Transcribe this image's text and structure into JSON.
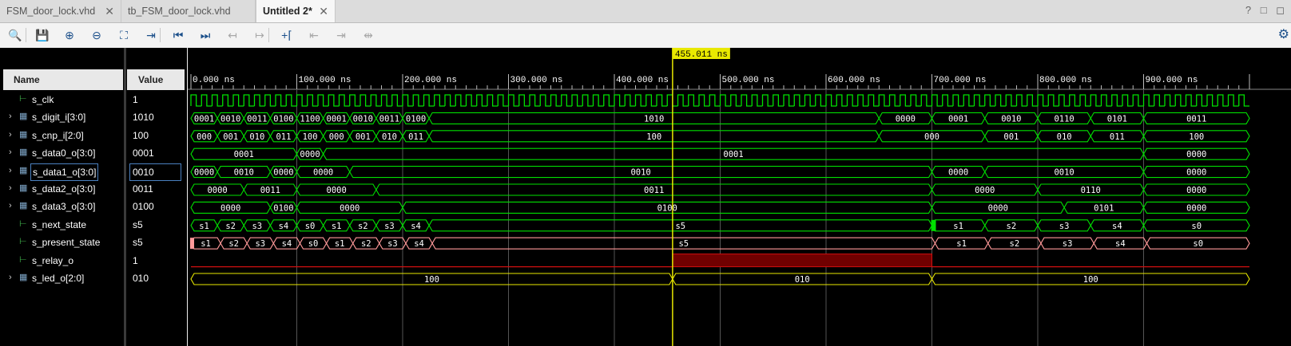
{
  "tabs": [
    {
      "label": "FSM_door_lock.vhd",
      "active": false
    },
    {
      "label": "tb_FSM_door_lock.vhd",
      "active": false
    },
    {
      "label": "Untitled 2*",
      "active": true
    }
  ],
  "window_controls": "? □ ◻",
  "toolbar": [
    {
      "icon": "search-icon",
      "glyph": "🔍",
      "enabled": true
    },
    {
      "icon": "save-icon",
      "glyph": "💾",
      "enabled": true
    },
    {
      "icon": "zoom-in-icon",
      "glyph": "⊕",
      "enabled": true
    },
    {
      "icon": "zoom-out-icon",
      "glyph": "⊖",
      "enabled": true
    },
    {
      "icon": "zoom-fit-icon",
      "glyph": "⛶",
      "enabled": true
    },
    {
      "icon": "go-to-cursor-icon",
      "glyph": "⇥",
      "enabled": true
    },
    {
      "icon": "go-to-time-0-icon",
      "glyph": "⏮",
      "enabled": true
    },
    {
      "icon": "go-to-last-time-icon",
      "glyph": "⏭",
      "enabled": true
    },
    {
      "icon": "previous-transition-icon",
      "glyph": "↤",
      "enabled": false
    },
    {
      "icon": "next-transition-icon",
      "glyph": "↦",
      "enabled": false
    },
    {
      "icon": "add-marker-icon",
      "glyph": "+⌈",
      "enabled": true
    },
    {
      "icon": "previous-marker-icon",
      "glyph": "⇤",
      "enabled": false
    },
    {
      "icon": "next-marker-icon",
      "glyph": "⇥",
      "enabled": false
    },
    {
      "icon": "swap-cursors-icon",
      "glyph": "⇹",
      "enabled": false
    }
  ],
  "headers": {
    "name": "Name",
    "value": "Value"
  },
  "cursor_label": "455.011 ns",
  "cursor_time": 455.011,
  "time_axis": {
    "start": 0,
    "end": 1000,
    "unit": "ns",
    "tick_labels": [
      "0.000 ns",
      "100.000 ns",
      "200.000 ns",
      "300.000 ns",
      "400.000 ns",
      "500.000 ns",
      "600.000 ns",
      "700.000 ns",
      "800.000 ns",
      "900.000 ns"
    ]
  },
  "colors": {
    "bus": "#00e000",
    "fsm_next": "#00e000",
    "fsm_present": "#ff9999",
    "led": "#e8e800",
    "cursor": "#e8e800",
    "relay_low": "#d01010",
    "relay_high": "#700000"
  },
  "signals": [
    {
      "name": "s_clk",
      "value": "1",
      "icon": "logic-signal-icon",
      "expandable": false,
      "type": "clock",
      "period": 10
    },
    {
      "name": "s_digit_i[3:0]",
      "value": "1010",
      "icon": "bus-signal-icon",
      "expandable": true,
      "type": "bus",
      "color": "bus",
      "segments": [
        [
          0,
          25,
          "0001"
        ],
        [
          25,
          50,
          "0010"
        ],
        [
          50,
          75,
          "0011"
        ],
        [
          75,
          100,
          "0100"
        ],
        [
          100,
          125,
          "1100"
        ],
        [
          125,
          150,
          "0001"
        ],
        [
          150,
          175,
          "0010"
        ],
        [
          175,
          200,
          "0011"
        ],
        [
          200,
          225,
          "0100"
        ],
        [
          225,
          650,
          "1010"
        ],
        [
          650,
          700,
          "0000"
        ],
        [
          700,
          750,
          "0001"
        ],
        [
          750,
          800,
          "0010"
        ],
        [
          800,
          850,
          "0110"
        ],
        [
          850,
          900,
          "0101"
        ],
        [
          900,
          1000,
          "0011"
        ]
      ]
    },
    {
      "name": "s_cnp_i[2:0]",
      "value": "100",
      "icon": "bus-signal-icon",
      "expandable": true,
      "type": "bus",
      "color": "bus",
      "segments": [
        [
          0,
          25,
          "000"
        ],
        [
          25,
          50,
          "001"
        ],
        [
          50,
          75,
          "010"
        ],
        [
          75,
          100,
          "011"
        ],
        [
          100,
          125,
          "100"
        ],
        [
          125,
          150,
          "000"
        ],
        [
          150,
          175,
          "001"
        ],
        [
          175,
          200,
          "010"
        ],
        [
          200,
          225,
          "011"
        ],
        [
          225,
          650,
          "100"
        ],
        [
          650,
          750,
          "000"
        ],
        [
          750,
          800,
          "001"
        ],
        [
          800,
          850,
          "010"
        ],
        [
          850,
          900,
          "011"
        ],
        [
          900,
          1000,
          "100"
        ]
      ]
    },
    {
      "name": "s_data0_o[3:0]",
      "value": "0001",
      "icon": "bus-signal-icon",
      "expandable": true,
      "type": "bus",
      "color": "bus",
      "segments": [
        [
          0,
          100,
          "0001"
        ],
        [
          100,
          125,
          "0000"
        ],
        [
          125,
          900,
          "0001"
        ],
        [
          900,
          1000,
          "0000"
        ]
      ]
    },
    {
      "name": "s_data1_o[3:0]",
      "value": "0010",
      "icon": "bus-signal-icon",
      "expandable": true,
      "type": "bus",
      "color": "bus",
      "selected": true,
      "segments": [
        [
          0,
          25,
          "0000"
        ],
        [
          25,
          75,
          "0010"
        ],
        [
          75,
          100,
          "0000"
        ],
        [
          100,
          150,
          "0000"
        ],
        [
          150,
          700,
          "0010"
        ],
        [
          700,
          750,
          "0000"
        ],
        [
          750,
          900,
          "0010"
        ],
        [
          900,
          1000,
          "0000"
        ]
      ]
    },
    {
      "name": "s_data2_o[3:0]",
      "value": "0011",
      "icon": "bus-signal-icon",
      "expandable": true,
      "type": "bus",
      "color": "bus",
      "segments": [
        [
          0,
          50,
          "0000"
        ],
        [
          50,
          100,
          "0011"
        ],
        [
          100,
          175,
          "0000"
        ],
        [
          175,
          700,
          "0011"
        ],
        [
          700,
          800,
          "0000"
        ],
        [
          800,
          900,
          "0110"
        ],
        [
          900,
          1000,
          "0000"
        ]
      ]
    },
    {
      "name": "s_data3_o[3:0]",
      "value": "0100",
      "icon": "bus-signal-icon",
      "expandable": true,
      "type": "bus",
      "color": "bus",
      "segments": [
        [
          0,
          75,
          "0000"
        ],
        [
          75,
          100,
          "0100"
        ],
        [
          100,
          200,
          "0000"
        ],
        [
          200,
          700,
          "0100"
        ],
        [
          700,
          825,
          "0000"
        ],
        [
          825,
          900,
          "0101"
        ],
        [
          900,
          1000,
          "0000"
        ]
      ]
    },
    {
      "name": "s_next_state",
      "value": "s5",
      "icon": "logic-signal-icon",
      "expandable": false,
      "type": "bus",
      "color": "fsm_next",
      "segments": [
        [
          0,
          25,
          "s1"
        ],
        [
          25,
          50,
          "s2"
        ],
        [
          50,
          75,
          "s3"
        ],
        [
          75,
          100,
          "s4"
        ],
        [
          100,
          125,
          "s0"
        ],
        [
          125,
          150,
          "s1"
        ],
        [
          150,
          175,
          "s2"
        ],
        [
          175,
          200,
          "s3"
        ],
        [
          200,
          225,
          "s4"
        ],
        [
          225,
          700,
          "s5"
        ],
        [
          700,
          750,
          "s1"
        ],
        [
          750,
          800,
          "s2"
        ],
        [
          800,
          850,
          "s3"
        ],
        [
          850,
          900,
          "s4"
        ],
        [
          900,
          1000,
          "s0"
        ]
      ],
      "marker_time": 700
    },
    {
      "name": "s_present_state",
      "value": "s5",
      "icon": "logic-signal-icon",
      "expandable": false,
      "type": "bus",
      "color": "fsm_present",
      "segments": [
        [
          0,
          28,
          "s1"
        ],
        [
          28,
          53,
          "s2"
        ],
        [
          53,
          78,
          "s3"
        ],
        [
          78,
          103,
          "s4"
        ],
        [
          103,
          128,
          "s0"
        ],
        [
          128,
          153,
          "s1"
        ],
        [
          153,
          178,
          "s2"
        ],
        [
          178,
          203,
          "s3"
        ],
        [
          203,
          228,
          "s4"
        ],
        [
          228,
          703,
          "s5"
        ],
        [
          703,
          753,
          "s1"
        ],
        [
          753,
          803,
          "s2"
        ],
        [
          803,
          853,
          "s3"
        ],
        [
          853,
          903,
          "s4"
        ],
        [
          903,
          1000,
          "s0"
        ]
      ]
    },
    {
      "name": "s_relay_o",
      "value": "1",
      "icon": "logic-signal-icon",
      "expandable": false,
      "type": "relay",
      "high": [
        455,
        700
      ]
    },
    {
      "name": "s_led_o[2:0]",
      "value": "010",
      "icon": "bus-signal-icon",
      "expandable": true,
      "type": "bus",
      "color": "led",
      "segments": [
        [
          0,
          455,
          "100"
        ],
        [
          455,
          700,
          "010"
        ],
        [
          700,
          1000,
          "100"
        ]
      ]
    }
  ]
}
